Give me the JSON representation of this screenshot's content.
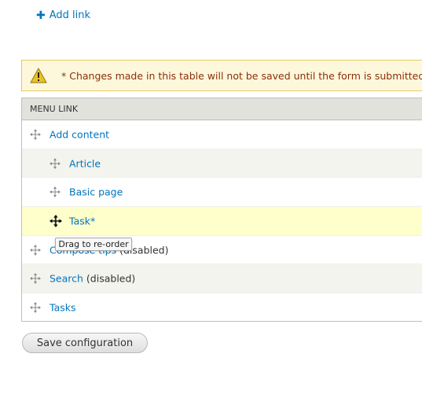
{
  "add_link": {
    "icon": "plus-icon",
    "label": "Add link"
  },
  "warning": {
    "icon": "warning-icon",
    "text": "* Changes made in this table will not be saved until the form is submitted."
  },
  "table": {
    "header": "MENU LINK",
    "rows": [
      {
        "label": "Add content",
        "suffix": "",
        "indent": 0
      },
      {
        "label": "Article",
        "suffix": "",
        "indent": 1
      },
      {
        "label": "Basic page",
        "suffix": "",
        "indent": 1
      },
      {
        "label": "Task",
        "suffix": "*",
        "indent": 1
      },
      {
        "label": "Compose tips",
        "suffix": " (disabled)",
        "indent": 0
      },
      {
        "label": "Search",
        "suffix": " (disabled)",
        "indent": 0
      },
      {
        "label": "Tasks",
        "suffix": "",
        "indent": 0
      }
    ]
  },
  "tooltip": "Drag to re-order",
  "save_button": "Save configuration"
}
